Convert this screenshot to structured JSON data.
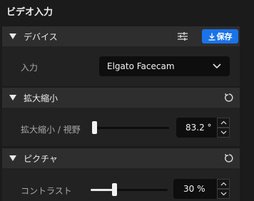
{
  "panel": {
    "title": "ビデオ入力"
  },
  "device": {
    "header_label": "デバイス",
    "save_label": "保存",
    "input_label": "入力",
    "input_value": "Elgato Facecam"
  },
  "zoom": {
    "header_label": "拡大縮小",
    "row_label": "拡大縮小 / 視野",
    "value": "83.2 °",
    "slider_level": 0.0
  },
  "picture": {
    "header_label": "ピクチャ",
    "contrast_label": "コントラスト",
    "contrast_value": "30 %",
    "contrast_level": 0.3
  },
  "colors": {
    "accent": "#1a73e8",
    "background": "#1b1b1b",
    "card": "#222222",
    "card_header": "#2e2e2e"
  },
  "icons": {
    "section_toggle": "triangle-down-icon",
    "settings": "sliders-icon",
    "save": "download-icon",
    "reset": "reset-icon",
    "dropdown": "chevron-down-icon",
    "step_up": "chevron-up-icon",
    "step_down": "chevron-down-icon"
  }
}
